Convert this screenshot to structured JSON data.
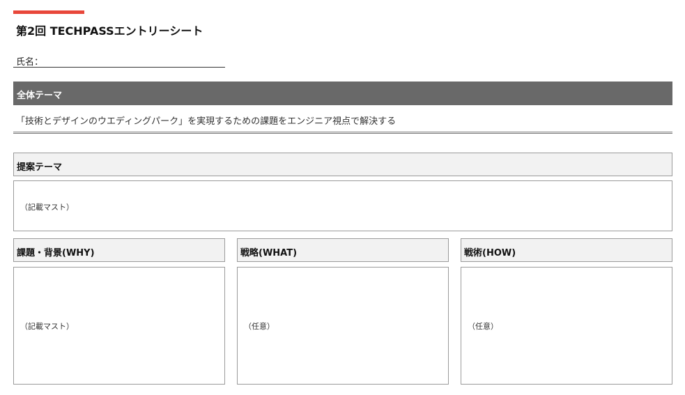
{
  "document": {
    "title": "第2回 TECHPASSエントリーシート",
    "accent_color": "#e8473a"
  },
  "name_field": {
    "label": "氏名："
  },
  "overall_theme": {
    "header": "全体テーマ",
    "text": "「技術とデザインのウエディングパーク」を実現するための課題をエンジニア視点で解決する",
    "header_color": "#696969"
  },
  "proposal_theme": {
    "header": "提案テーマ",
    "hint": "（記載マスト）"
  },
  "columns": [
    {
      "header": "課題・背景(WHY)",
      "hint": "（記載マスト）"
    },
    {
      "header": "戦略(WHAT)",
      "hint": "（任意）"
    },
    {
      "header": "戦術(HOW)",
      "hint": "（任意）"
    }
  ]
}
